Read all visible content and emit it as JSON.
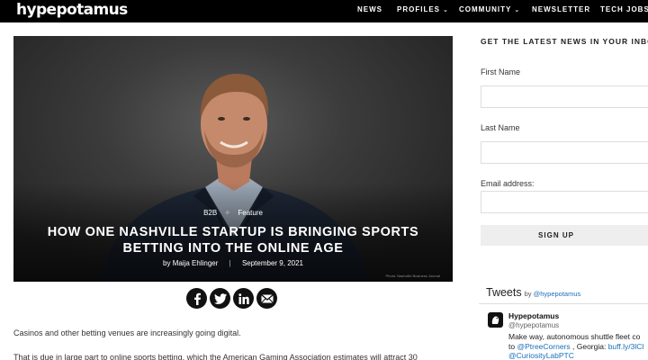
{
  "brand": {
    "logo": "hypepotamus"
  },
  "nav": {
    "items": [
      {
        "label": "NEWS",
        "has_menu": false
      },
      {
        "label": "PROFILES",
        "has_menu": true
      },
      {
        "label": "COMMUNITY",
        "has_menu": true
      },
      {
        "label": "NEWSLETTER",
        "has_menu": false
      },
      {
        "label": "TECH JOBS",
        "has_menu": true
      }
    ]
  },
  "hero": {
    "categories": [
      "B2B",
      "Feature"
    ],
    "category_separator": "✧",
    "headline": "HOW ONE NASHVILLE STARTUP IS BRINGING SPORTS BETTING INTO THE ONLINE AGE",
    "author": "by Maija Ehlinger",
    "date": "September 9, 2021",
    "photo_credit": "Photo: Nashville Business Journal"
  },
  "share": {
    "icons": [
      "facebook-icon",
      "twitter-icon",
      "linkedin-icon",
      "email-icon"
    ]
  },
  "article": {
    "paragraphs": [
      "Casinos and other betting venues are increasingly going digital.",
      "That is due in large part to online sports betting, which the American Gaming Association estimates will attract 30"
    ]
  },
  "sidebar": {
    "newsletter": {
      "title": "GET THE LATEST NEWS IN YOUR INBOX",
      "first_name_label": "First Name",
      "first_name_value": "",
      "last_name_label": "Last Name",
      "last_name_value": "",
      "email_label": "Email address:",
      "email_value": "",
      "signup_label": "SIGN UP"
    },
    "tweets": {
      "title": "Tweets",
      "by_prefix": "by",
      "by_handle": "@hypepotamus",
      "tweet": {
        "name": "Hypepotamus",
        "handle": "@hypepotamus",
        "line1": "Make way,  autonomous shuttle fleet co",
        "line2_prefix": "to ",
        "line2_link": "@PtreeCorners",
        "line2_mid": " , Georgia: ",
        "line2_link2": "buff.ly/3lCl",
        "line3_link": "@CuriosityLabPTC"
      }
    }
  },
  "colors": {
    "topbar": "#000000",
    "link": "#1b6fb8",
    "signup_bg": "#eeeeee"
  }
}
